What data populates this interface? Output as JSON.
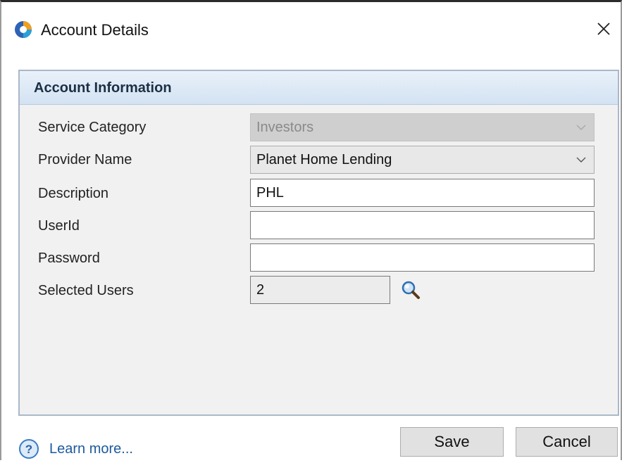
{
  "window": {
    "title": "Account Details",
    "app_icon": "app-logo-icon",
    "close_icon": "close-icon",
    "close_glyph": "✕"
  },
  "panel": {
    "header": "Account Information",
    "fields": {
      "service_category": {
        "label": "Service Category",
        "value": "Investors",
        "disabled": true
      },
      "provider_name": {
        "label": "Provider Name",
        "value": "Planet Home Lending"
      },
      "description": {
        "label": "Description",
        "value": "PHL"
      },
      "user_id": {
        "label": "UserId",
        "value": ""
      },
      "password": {
        "label": "Password",
        "value": ""
      },
      "selected_users": {
        "label": "Selected Users",
        "value": "2",
        "lookup_icon": "magnifier-icon"
      }
    }
  },
  "footer": {
    "help_label": "Learn more...",
    "help_icon": "help-question-icon",
    "save_label": "Save",
    "cancel_label": "Cancel"
  },
  "colors": {
    "header_gradient_top": "#e9f1fa",
    "header_gradient_bottom": "#d3e2f2",
    "link": "#1c5a9c",
    "disabled_field": "#cfcfcf"
  }
}
